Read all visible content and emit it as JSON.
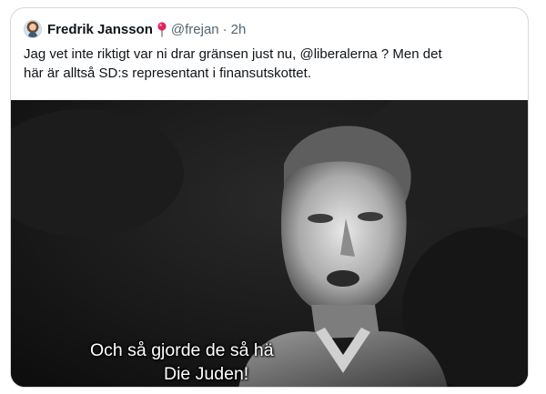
{
  "tweet": {
    "author": {
      "display_name": "Fredrik Jansson",
      "handle": "@frejan",
      "emoji_icon": "pin-icon"
    },
    "separator": "·",
    "time": "2h",
    "text_lines": [
      "Jag vet inte riktigt var ni drar gränsen just nu, @liberalerna ? Men det",
      "här är alltså SD:s representant i finansutskottet."
    ],
    "media": {
      "subtitles": [
        "Och så gjorde de så hä",
        "Die Juden!"
      ]
    }
  },
  "colors": {
    "border": "#cfd9de",
    "secondary_text": "#536471",
    "primary_text": "#0f1419",
    "media_background": "#151515",
    "pin": "#e0245e"
  }
}
